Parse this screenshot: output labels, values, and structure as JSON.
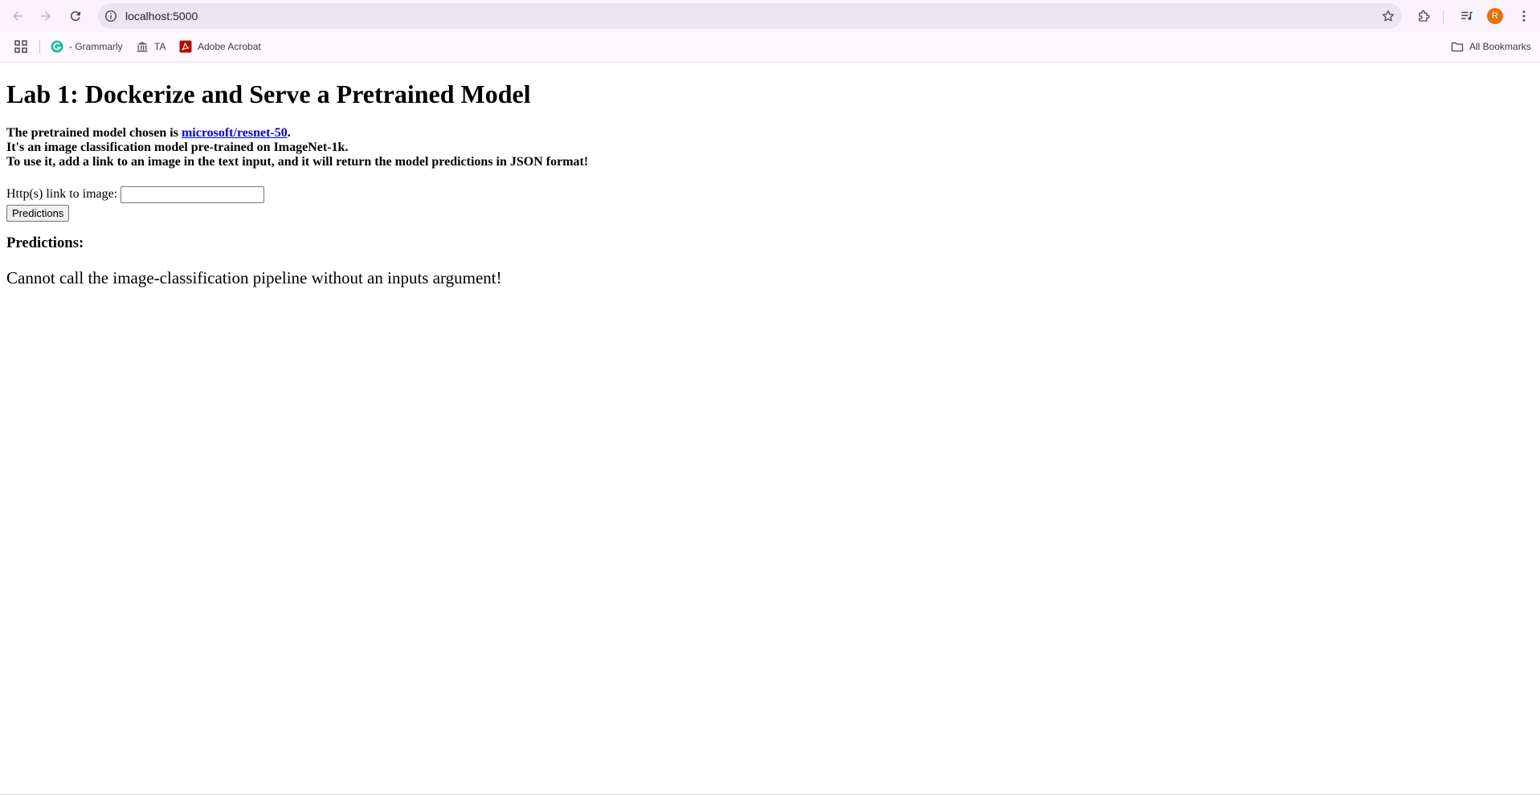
{
  "browser": {
    "url": "localhost:5000",
    "avatar_letter": "R",
    "accent_color": "#e8710a",
    "icons": [
      "back-arrow-icon",
      "forward-arrow-icon",
      "reload-icon",
      "site-info-icon",
      "star-icon",
      "extensions-icon",
      "media-control-icon",
      "kebab-menu-icon"
    ]
  },
  "bookmarks": {
    "items": [
      {
        "label": "- Grammarly",
        "icon": "grammarly-icon"
      },
      {
        "label": "TA",
        "icon": "bank-icon"
      },
      {
        "label": "Adobe Acrobat",
        "icon": "acrobat-icon"
      }
    ],
    "all_bookmarks_label": "All Bookmarks"
  },
  "page": {
    "title": "Lab 1: Dockerize and Serve a Pretrained Model",
    "intro_prefix": "The pretrained model chosen is ",
    "model_link": "microsoft/resnet-50",
    "intro_suffix": ".",
    "intro_line2": "It's an image classification model pre-trained on ImageNet-1k.",
    "intro_line3": "To use it, add a link to an image in the text input, and it will return the model predictions in JSON format!",
    "input_label": "Http(s) link to image:",
    "input_value": "",
    "button_label": "Predictions",
    "predictions_heading": "Predictions:",
    "predictions_output": "Cannot call the image-classification pipeline without an inputs argument!"
  }
}
